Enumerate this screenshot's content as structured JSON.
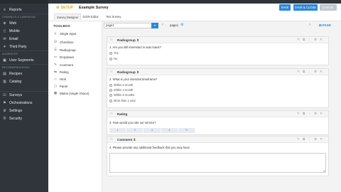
{
  "sidebar": {
    "items_top": [
      {
        "label": "Reports",
        "icon": "reports-icon",
        "glyph": "≡"
      }
    ],
    "section_channels": "CHANNELS & CAMPAIGNS",
    "channels": [
      {
        "label": "Web",
        "icon": "globe-icon",
        "glyph": "⊕"
      },
      {
        "label": "Mobile",
        "icon": "mobile-icon",
        "glyph": "▯"
      },
      {
        "label": "Email",
        "icon": "email-icon",
        "glyph": "✉"
      },
      {
        "label": "Third Party",
        "icon": "third-party-icon",
        "glyph": "✈"
      }
    ],
    "section_audiences": "AUDIENCES",
    "audiences": [
      {
        "label": "User Segments",
        "icon": "user-segments-icon",
        "glyph": "▣"
      }
    ],
    "section_recommendations": "RECOMMENDATIONS",
    "recommendations": [
      {
        "label": "Recipes",
        "icon": "recipes-icon",
        "glyph": "▤"
      },
      {
        "label": "Catalog",
        "icon": "catalog-icon",
        "glyph": "▥"
      }
    ],
    "bottom": [
      {
        "label": "Surveys",
        "icon": "surveys-icon",
        "glyph": "☑"
      },
      {
        "label": "Orchestrations",
        "icon": "orchestrations-icon",
        "glyph": "⚑"
      },
      {
        "label": "Settings",
        "icon": "settings-icon",
        "glyph": "⚙"
      },
      {
        "label": "Security",
        "icon": "security-icon",
        "glyph": "⛨"
      }
    ]
  },
  "header": {
    "setup_label": "SETUP",
    "title": "Example Survey",
    "save": "SAVE",
    "save_close": "SAVE & CLOSE",
    "cancel": "CANCEL",
    "tabs": [
      "Survey Designer",
      "JSON Editor",
      "Test Survey"
    ]
  },
  "toolbox": {
    "title": "TOOLBOX",
    "items": [
      {
        "label": "Single Input",
        "icon": "single-input-icon",
        "glyph": "T"
      },
      {
        "label": "Checkbox",
        "icon": "checkbox-icon",
        "glyph": "☑"
      },
      {
        "label": "Radiogroup",
        "icon": "radiogroup-icon",
        "glyph": "☰"
      },
      {
        "label": "Dropdown",
        "icon": "dropdown-icon",
        "glyph": "▭"
      },
      {
        "label": "Comment",
        "icon": "comment-icon",
        "glyph": "✎"
      },
      {
        "label": "Rating",
        "icon": "rating-icon",
        "glyph": "⇆"
      },
      {
        "label": "Html",
        "icon": "html-icon",
        "glyph": "</>"
      },
      {
        "label": "Panel",
        "icon": "panel-icon",
        "glyph": "▢"
      },
      {
        "label": "Matrix (single choice)",
        "icon": "matrix-icon",
        "glyph": "▦"
      }
    ]
  },
  "pagebar": {
    "select_value": "page1",
    "page_label": "page1",
    "add_page": "PAGE"
  },
  "questions": [
    {
      "type": "Radiogroup",
      "title": "1. Are you still interested in auto loans?",
      "options": [
        "Yes",
        "No"
      ]
    },
    {
      "type": "Radiogroup",
      "title": "2. What is your intended timeframe?",
      "options": [
        "Within a month",
        "Within 3 month",
        "Within 6 months",
        "More than 1 year"
      ]
    },
    {
      "type": "Rating",
      "title": "3. How would you rate our service?",
      "rates": [
        "1",
        "2",
        "3",
        "4",
        "5"
      ]
    },
    {
      "type": "Comment",
      "title": "4. Please provide any additional feedback that you may have."
    }
  ],
  "colors": {
    "accent": "#2c87d6",
    "setup": "#f0a31a",
    "sidebar": "#2f353b"
  }
}
